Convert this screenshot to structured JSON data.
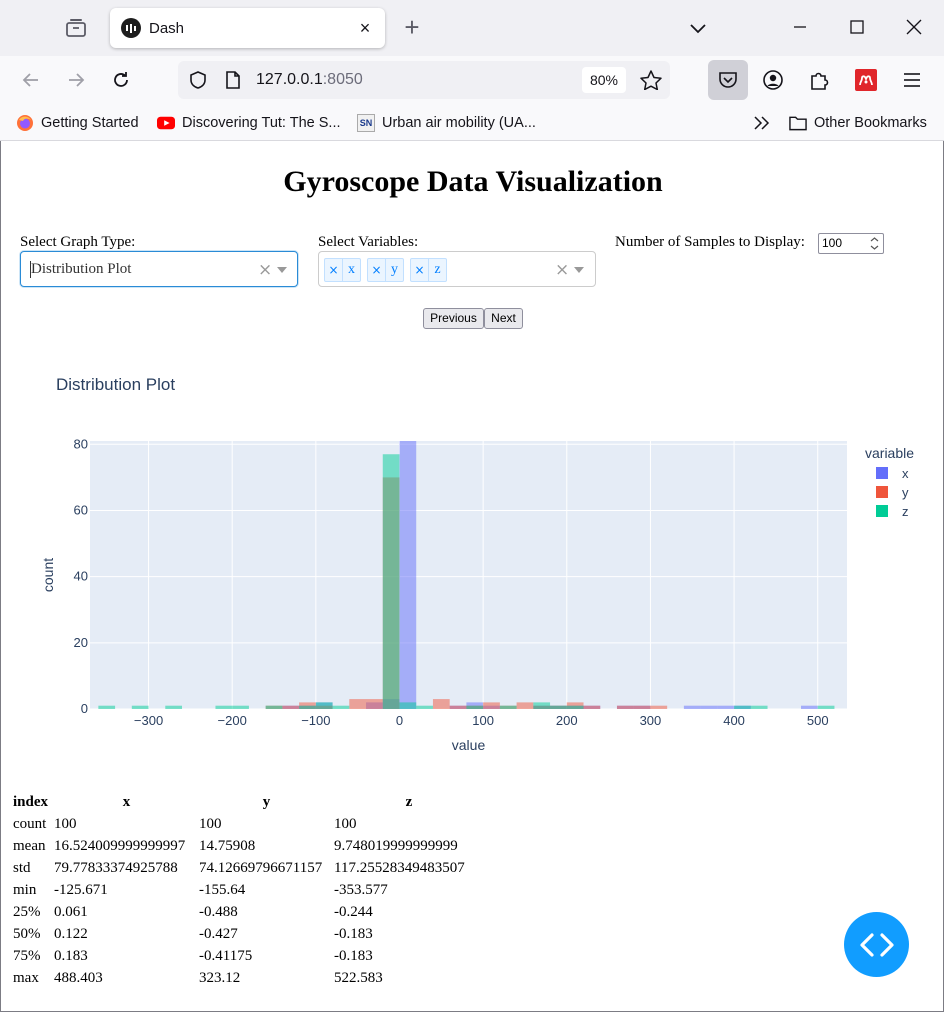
{
  "browser": {
    "tab": {
      "title": "Dash",
      "close": "×"
    },
    "new_tab": "+",
    "url": {
      "host": "127.0.0.1",
      "port": ":8050"
    },
    "zoom": "80%",
    "bookmarks": [
      {
        "label": "Getting Started",
        "icon": "firefox-icon"
      },
      {
        "label": "Discovering Tut: The S...",
        "icon": "youtube-icon"
      },
      {
        "label": "Urban air mobility (UA...",
        "icon": "sn-icon",
        "badge": "SN"
      }
    ],
    "other_bookmarks": "Other Bookmarks"
  },
  "app": {
    "title": "Gyroscope Data Visualization",
    "graph_type": {
      "label": "Select Graph Type:",
      "value": "Distribution Plot",
      "clear": "×"
    },
    "variables": {
      "label": "Select Variables:",
      "values": [
        "x",
        "y",
        "z"
      ],
      "remove": "×",
      "clear": "×"
    },
    "samples": {
      "label": "Number of Samples to Display:",
      "value": "100"
    },
    "prev_label": "Previous",
    "next_label": "Next"
  },
  "chart_data": {
    "type": "bar",
    "title": "Distribution Plot",
    "xlabel": "value",
    "ylabel": "count",
    "legend_title": "variable",
    "legend_position": "right",
    "grid": true,
    "bar_opacity": 0.5,
    "xlim": [
      -370,
      535
    ],
    "ylim": [
      0,
      81
    ],
    "xticks": [
      -300,
      -200,
      -100,
      0,
      100,
      200,
      300,
      400,
      500
    ],
    "yticks": [
      0,
      20,
      40,
      60,
      80
    ],
    "bin_width": 20,
    "series": [
      {
        "name": "x",
        "color": "#636efa",
        "x": [
          -130,
          -110,
          -90,
          -30,
          -10,
          10,
          70,
          90,
          110,
          170,
          190,
          210,
          230,
          270,
          290,
          350,
          370,
          390,
          410,
          490
        ],
        "y": [
          1,
          1,
          2,
          2,
          3,
          84,
          1,
          2,
          1,
          1,
          1,
          1,
          1,
          1,
          1,
          1,
          1,
          1,
          1,
          1
        ]
      },
      {
        "name": "y",
        "color": "#ef553b",
        "x": [
          -150,
          -130,
          -110,
          -90,
          -50,
          -30,
          -10,
          50,
          70,
          90,
          110,
          130,
          150,
          170,
          190,
          210,
          230,
          270,
          290,
          310
        ],
        "y": [
          1,
          1,
          2,
          1,
          3,
          3,
          70,
          3,
          1,
          1,
          2,
          1,
          2,
          1,
          1,
          2,
          1,
          1,
          1,
          1
        ]
      },
      {
        "name": "z",
        "color": "#00cc96",
        "x": [
          -350,
          -310,
          -270,
          -210,
          -190,
          -150,
          -110,
          -90,
          -70,
          -10,
          10,
          30,
          90,
          130,
          170,
          190,
          210,
          410,
          430,
          510
        ],
        "y": [
          1,
          1,
          1,
          1,
          1,
          1,
          1,
          2,
          1,
          77,
          2,
          1,
          1,
          1,
          2,
          1,
          1,
          1,
          1,
          1
        ]
      }
    ]
  },
  "stats": {
    "columns": [
      "index",
      "x",
      "y",
      "z"
    ],
    "rows": [
      [
        "count",
        "100",
        "100",
        "100"
      ],
      [
        "mean",
        "16.524009999999997",
        "14.75908",
        "9.748019999999999"
      ],
      [
        "std",
        "79.77833374925788",
        "74.12669796671157",
        "117.25528349483507"
      ],
      [
        "min",
        "-125.671",
        "-155.64",
        "-353.577"
      ],
      [
        "25%",
        "0.061",
        "-0.488",
        "-0.244"
      ],
      [
        "50%",
        "0.122",
        "-0.427",
        "-0.183"
      ],
      [
        "75%",
        "0.183",
        "-0.41175",
        "-0.183"
      ],
      [
        "max",
        "488.403",
        "323.12",
        "522.583"
      ]
    ]
  }
}
